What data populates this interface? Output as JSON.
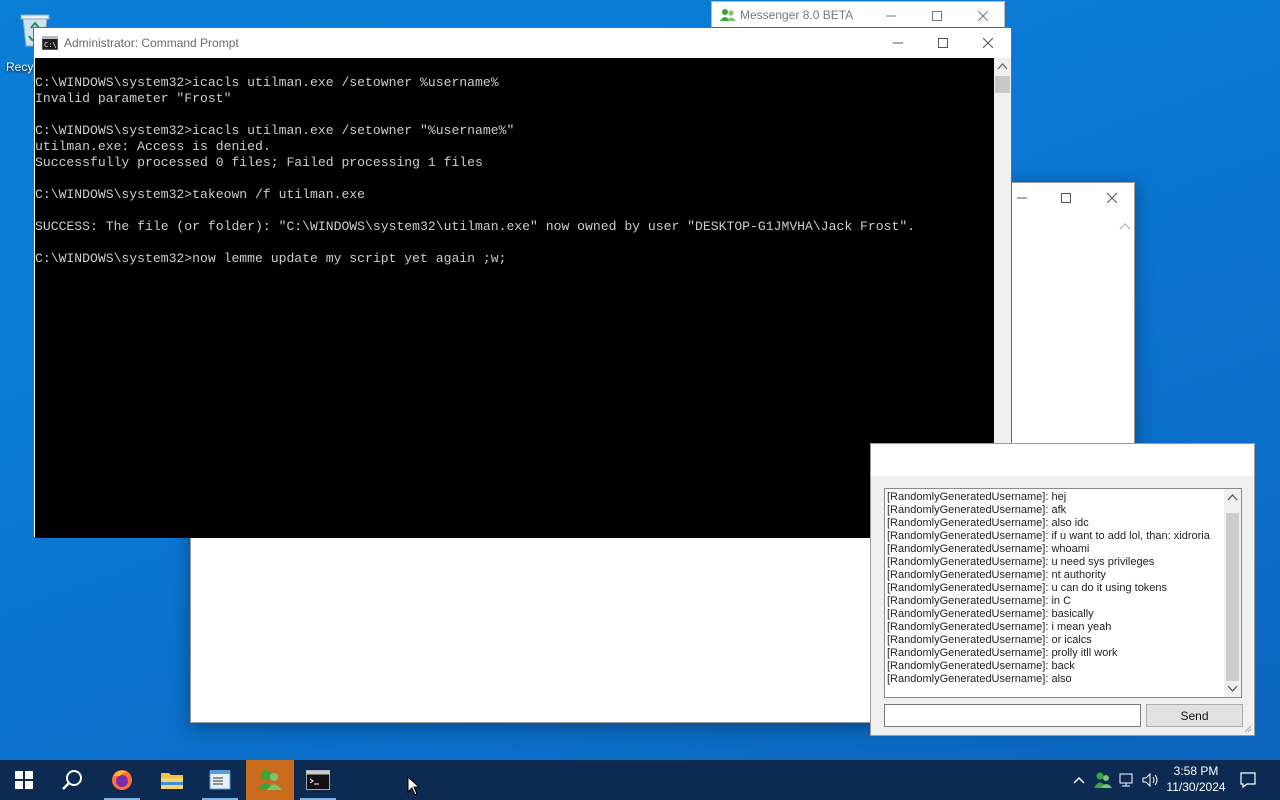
{
  "desktop": {
    "recycle_bin_label": "Recy"
  },
  "messenger_window": {
    "title": "Messenger 8.0 BETA"
  },
  "cmd_window": {
    "title": "Administrator: Command Prompt",
    "console_lines": [
      "C:\\WINDOWS\\system32>icacls utilman.exe /setowner %username%",
      "Invalid parameter \"Frost\"",
      "",
      "C:\\WINDOWS\\system32>icacls utilman.exe /setowner \"%username%\"",
      "utilman.exe: Access is denied.",
      "Successfully processed 0 files; Failed processing 1 files",
      "",
      "C:\\WINDOWS\\system32>takeown /f utilman.exe",
      "",
      "SUCCESS: The file (or folder): \"C:\\WINDOWS\\system32\\utilman.exe\" now owned by user \"DESKTOP-G1JMVHA\\Jack Frost\".",
      "",
      "C:\\WINDOWS\\system32>now lemme update my script yet again ;w;"
    ]
  },
  "chat_window": {
    "messages": [
      "[RandomlyGeneratedUsername]: hej",
      "[RandomlyGeneratedUsername]: afk",
      "[RandomlyGeneratedUsername]: also idc",
      "[RandomlyGeneratedUsername]: if u want to add lol, than: xidroria",
      "[RandomlyGeneratedUsername]: whoami",
      "[RandomlyGeneratedUsername]: u need sys privileges",
      "[RandomlyGeneratedUsername]: nt authority",
      "[RandomlyGeneratedUsername]: u can do it using tokens",
      "[RandomlyGeneratedUsername]: in C",
      "[RandomlyGeneratedUsername]: basically",
      "[RandomlyGeneratedUsername]: i mean yeah",
      "[RandomlyGeneratedUsername]: or icalcs",
      "[RandomlyGeneratedUsername]: prolly itll work",
      "[RandomlyGeneratedUsername]: back",
      "[RandomlyGeneratedUsername]: also"
    ],
    "input_value": "",
    "send_label": "Send"
  },
  "taskbar": {
    "items": [
      "start-icon",
      "search-icon",
      "firefox-icon",
      "file-explorer-icon",
      "notepad-icon",
      "messenger-icon",
      "command-prompt-icon"
    ],
    "active_item": "messenger-icon",
    "clock_time": "3:58 PM",
    "clock_date": "11/30/2024"
  },
  "colors": {
    "desktop": "#0a78d4",
    "taskbar": "#0c2a52",
    "active_taskbar": "#c86b1c",
    "console_bg": "#000000",
    "console_fg": "#cccccc"
  }
}
